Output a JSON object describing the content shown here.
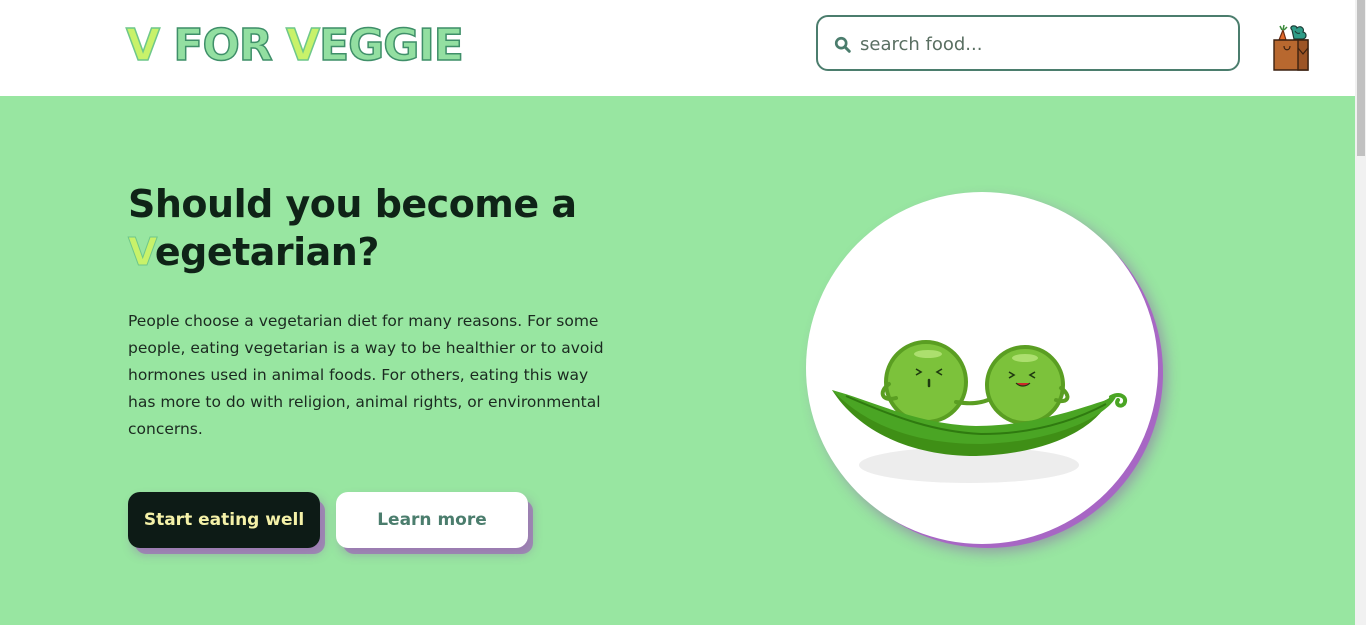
{
  "header": {
    "logo_v": "V",
    "logo_rest": " FOR ",
    "logo_v2": "V",
    "logo_rest2": "EGGIE",
    "search": {
      "placeholder": "search food...",
      "value": ""
    },
    "cart_icon": "grocery-bag-icon"
  },
  "hero": {
    "title_line1": "Should you become a",
    "title_v": "V",
    "title_line2_rest": "egetarian?",
    "description": "People choose a vegetarian diet for many reasons. For some people, eating vegetarian is a way to be healthier or to avoid hormones used in animal foods. For others, eating this way has more to do with religion, animal rights, or environmental concerns.",
    "primary_button": "Start eating well",
    "secondary_button": "Learn more",
    "illustration": "peas-in-pod-illustration"
  },
  "colors": {
    "hero_bg": "#98e6a1",
    "logo_accent": "#c8f26a",
    "primary_btn_bg": "#0d1b16",
    "primary_btn_text": "#f4f1a8",
    "shadow_purple": "#aa5fc8",
    "border_green": "#4b7d6d"
  }
}
